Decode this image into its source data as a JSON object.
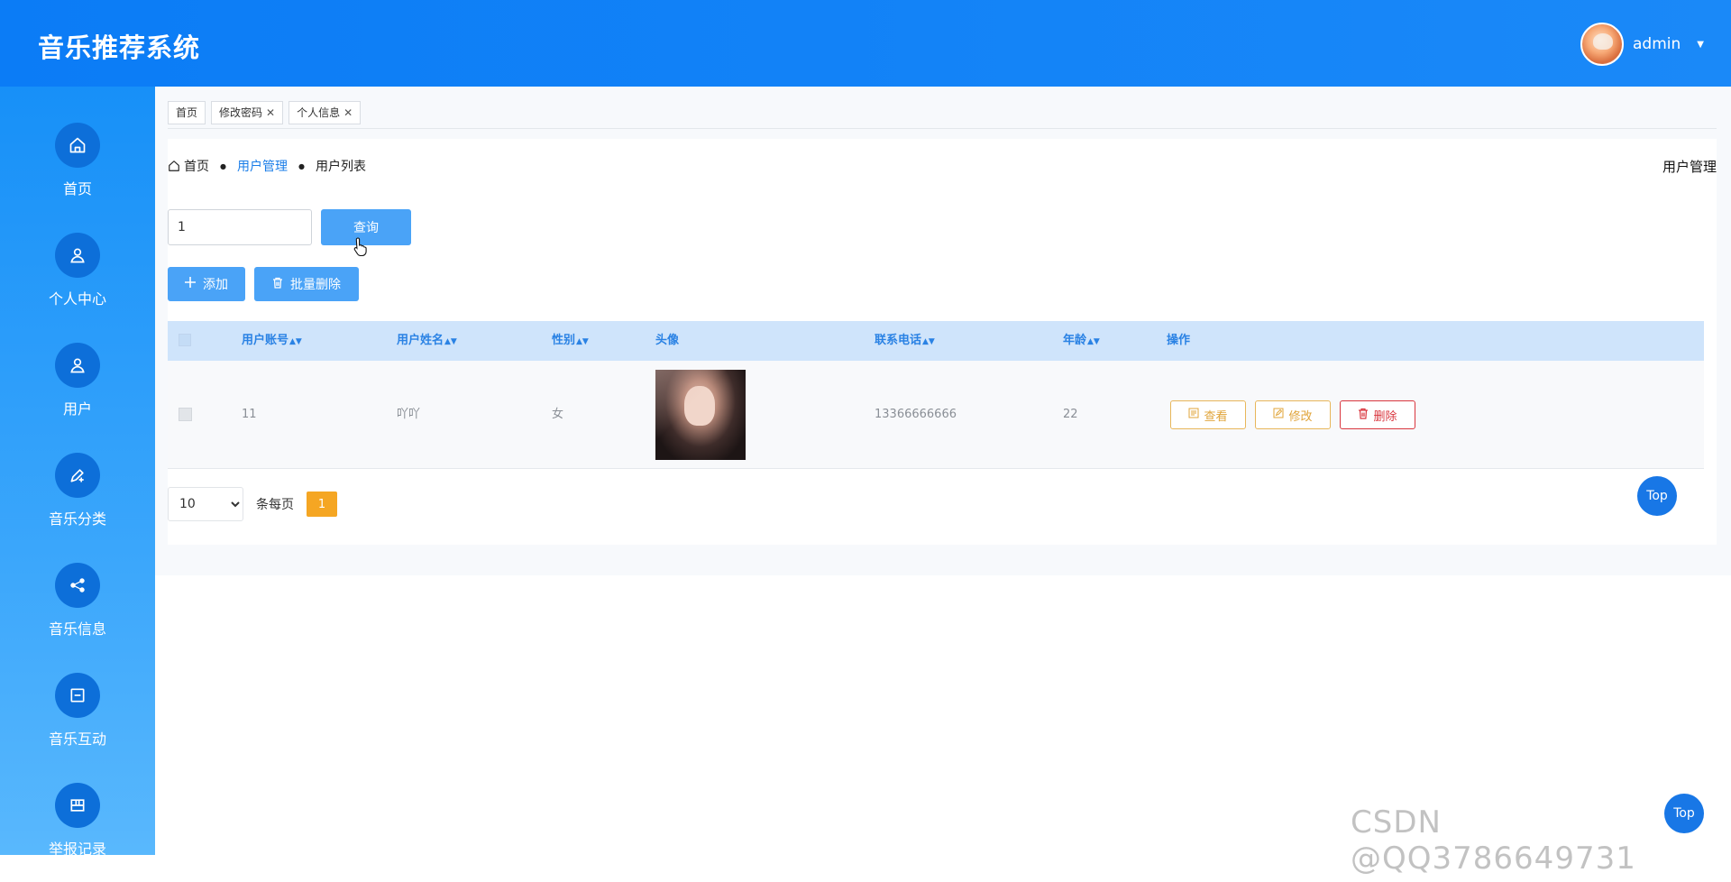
{
  "header": {
    "title": "音乐推荐系统",
    "username": "admin"
  },
  "sidebar": {
    "items": [
      {
        "label": "首页",
        "icon": "home-icon"
      },
      {
        "label": "个人中心",
        "icon": "user-icon"
      },
      {
        "label": "用户",
        "icon": "user-icon"
      },
      {
        "label": "音乐分类",
        "icon": "pen-plus-icon"
      },
      {
        "label": "音乐信息",
        "icon": "share-icon"
      },
      {
        "label": "音乐互动",
        "icon": "square-minus-icon"
      },
      {
        "label": "举报记录",
        "icon": "grid-icon"
      }
    ]
  },
  "tabs": [
    {
      "label": "首页",
      "closable": false
    },
    {
      "label": "修改密码",
      "closable": true
    },
    {
      "label": "个人信息",
      "closable": true
    }
  ],
  "breadcrumb": {
    "home": "首页",
    "section": "用户管理",
    "current": "用户列表"
  },
  "page": {
    "title": "用户管理"
  },
  "search": {
    "value": "1",
    "button": "查询"
  },
  "toolbar": {
    "add": "添加",
    "batch_delete": "批量删除"
  },
  "table": {
    "headers": {
      "account": "用户账号",
      "name": "用户姓名",
      "gender": "性别",
      "avatar": "头像",
      "phone": "联系电话",
      "age": "年龄",
      "actions": "操作"
    },
    "rows": [
      {
        "account": "11",
        "name": "吖吖",
        "gender": "女",
        "phone": "13366666666",
        "age": "22"
      }
    ],
    "actions": {
      "view": "查看",
      "edit": "修改",
      "delete": "删除"
    }
  },
  "pagination": {
    "page_size": "10",
    "page_size_options": [
      "10"
    ],
    "per_page_label": "条每页",
    "current_page": "1"
  },
  "back_to_top": "Top",
  "watermark": "CSDN @QQ3786649731",
  "colors": {
    "primary": "#0b7cf6",
    "button": "#4aa3f7",
    "warning": "#e0a43a",
    "danger": "#d9363e",
    "page_active": "#f5a623"
  }
}
